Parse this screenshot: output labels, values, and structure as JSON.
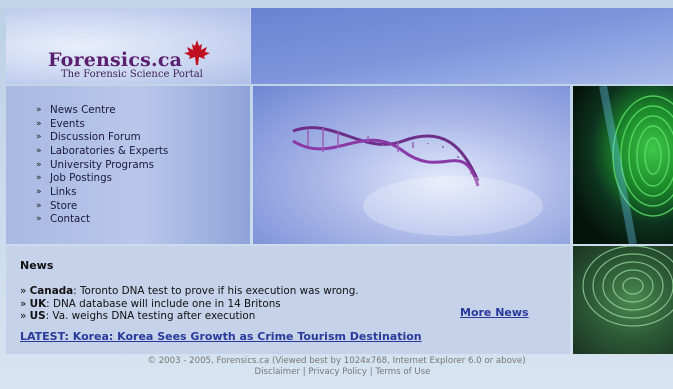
{
  "header": {
    "logo_title": "Forensics.ca",
    "logo_subtitle": "The Forensic Science Portal",
    "brand_color": "#5a1f6e",
    "leaf_color": "#c01020"
  },
  "nav": {
    "items": [
      {
        "label": "News Centre"
      },
      {
        "label": "Events"
      },
      {
        "label": "Discussion Forum"
      },
      {
        "label": "Laboratories & Experts"
      },
      {
        "label": "University Programs"
      },
      {
        "label": "Job Postings"
      },
      {
        "label": "Links"
      },
      {
        "label": "Store"
      },
      {
        "label": "Contact"
      }
    ],
    "arrow": "»"
  },
  "news": {
    "title": "News",
    "items": [
      {
        "bullet": "»",
        "country": "Canada",
        "text": ": Toronto DNA test to prove if his execution was wrong."
      },
      {
        "bullet": "»",
        "country": "UK",
        "text": ": DNA database will include one in 14 Britons"
      },
      {
        "bullet": "»",
        "country": "US",
        "text": ": Va. weighs DNA testing after execution"
      }
    ],
    "more_label": "More News",
    "latest_label": "LATEST: Korea: Korea Sees Growth as Crime Tourism Destination",
    "link_color": "#2a3a9a"
  },
  "footer": {
    "copyright": "© 2003 - 2005, Forensics.ca (Viewed best by 1024x768, Internet Explorer 6.0 or above)",
    "links": [
      "Disclaimer",
      "Privacy Policy",
      "Terms of Use"
    ],
    "separator": "|"
  }
}
